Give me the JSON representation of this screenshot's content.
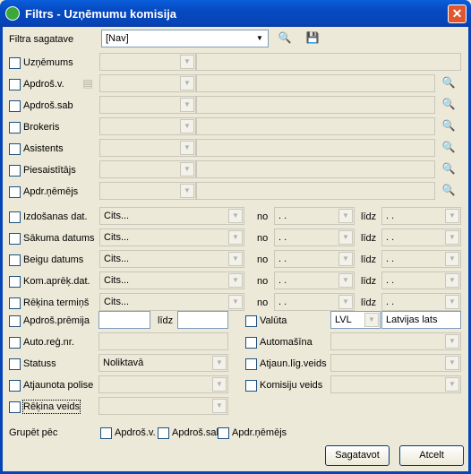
{
  "window": {
    "title": "Filtrs - Uzņēmumu komisija",
    "close_glyph": "✕"
  },
  "preset": {
    "label": "Filtra sagatave",
    "value": "[Nav]"
  },
  "icons": {
    "search": "🔍",
    "save": "💾",
    "card": "▤",
    "arrow": "▼"
  },
  "rows": [
    {
      "label": "Uzņēmums"
    },
    {
      "label": "Apdroš.v."
    },
    {
      "label": "Apdroš.sab"
    },
    {
      "label": "Brokeris"
    },
    {
      "label": "Asistents"
    },
    {
      "label": "Piesaistītājs"
    },
    {
      "label": "Apdr.ņēmējs"
    }
  ],
  "date_rows": [
    {
      "label": "Izdošanas dat.",
      "value": "Cits...",
      "from_label": "no",
      "from_value": ". .",
      "to_label": "līdz",
      "to_value": ". ."
    },
    {
      "label": "Sākuma datums",
      "value": "Cits...",
      "from_label": "no",
      "from_value": ". .",
      "to_label": "līdz",
      "to_value": ". ."
    },
    {
      "label": "Beigu datums",
      "value": "Cits...",
      "from_label": "no",
      "from_value": ". .",
      "to_label": "līdz",
      "to_value": ". ."
    },
    {
      "label": "Kom.aprēķ.dat.",
      "value": "Cits...",
      "from_label": "no",
      "from_value": ". .",
      "to_label": "līdz",
      "to_value": ". ."
    },
    {
      "label": "Rēķina termiņš",
      "value": "Cits...",
      "from_label": "no",
      "from_value": ". .",
      "to_label": "līdz",
      "to_value": ". ."
    }
  ],
  "premium": {
    "label": "Apdroš.prēmija",
    "to_label": "līdz"
  },
  "currency": {
    "label": "Valūta",
    "code": "LVL",
    "name": "Latvijas lats"
  },
  "auto_reg": {
    "label": "Auto.reģ.nr."
  },
  "auto": {
    "label": "Automašīna"
  },
  "status": {
    "label": "Statuss",
    "value": "Noliktavā"
  },
  "renew_type": {
    "label": "Atjaun.līg.veids"
  },
  "renewed": {
    "label": "Atjaunota polise"
  },
  "commission_type": {
    "label": "Komisiju veids"
  },
  "invoice_type": {
    "label": "Rēķina veids"
  },
  "group": {
    "label": "Grupēt pēc",
    "options": [
      "Apdroš.v.",
      "Apdroš.sab",
      "Apdr.ņēmējs"
    ]
  },
  "buttons": {
    "prepare": "Sagatavot",
    "cancel": "Atcelt"
  }
}
